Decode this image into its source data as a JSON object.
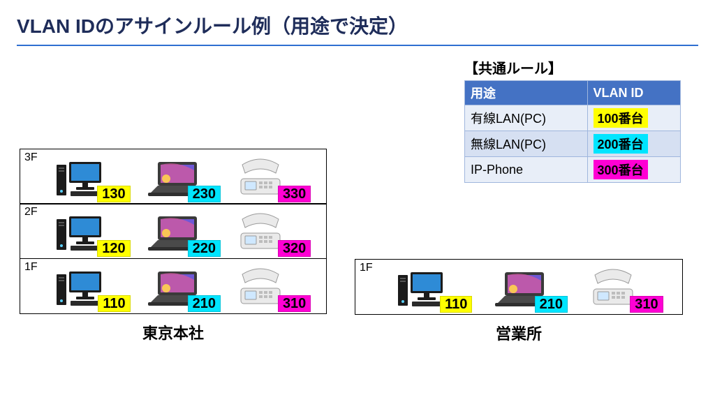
{
  "title": "VLAN IDのアサインルール例（用途で決定）",
  "rule": {
    "heading": "【共通ルール】",
    "col1": "用途",
    "col2": "VLAN ID",
    "rows": [
      {
        "use": "有線LAN(PC)",
        "vlan": "100番台",
        "cls": "chip-yellow"
      },
      {
        "use": "無線LAN(PC)",
        "vlan": "200番台",
        "cls": "chip-cyan"
      },
      {
        "use": "IP-Phone",
        "vlan": "300番台",
        "cls": "chip-magenta"
      }
    ]
  },
  "hq": {
    "name": "東京本社",
    "floors": [
      {
        "label": "3F",
        "pc": "130",
        "laptop": "230",
        "phone": "330"
      },
      {
        "label": "2F",
        "pc": "120",
        "laptop": "220",
        "phone": "320"
      },
      {
        "label": "1F",
        "pc": "110",
        "laptop": "210",
        "phone": "310"
      }
    ]
  },
  "branch": {
    "name": "営業所",
    "floors": [
      {
        "label": "1F",
        "pc": "110",
        "laptop": "210",
        "phone": "310"
      }
    ]
  }
}
